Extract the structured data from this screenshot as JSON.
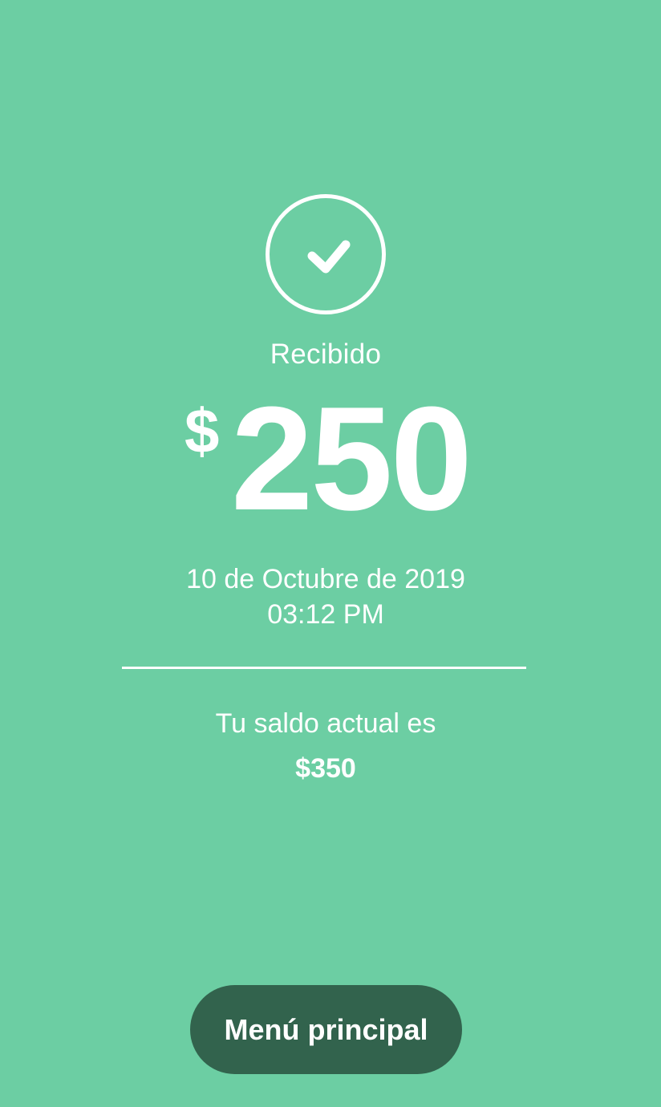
{
  "confirmation": {
    "icon": "check-circle-icon",
    "status_label": "Recibido",
    "currency_symbol": "$",
    "amount": "250",
    "date": "10 de Octubre de 2019",
    "time": "03:12 PM"
  },
  "balance": {
    "label": "Tu saldo actual es",
    "value": "$350"
  },
  "actions": {
    "main_menu_label": "Menú principal"
  },
  "colors": {
    "background": "#6ccea3",
    "button": "#32634d",
    "text": "#ffffff"
  }
}
